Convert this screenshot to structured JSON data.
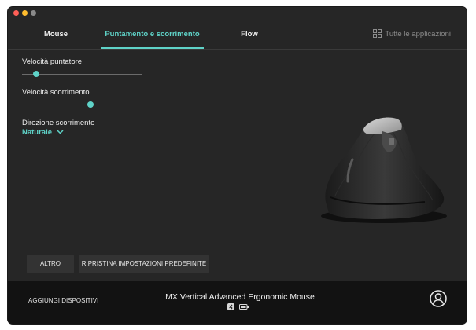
{
  "tabs": [
    {
      "label": "Mouse",
      "active": false
    },
    {
      "label": "Puntamento e scorrimento",
      "active": true
    },
    {
      "label": "Flow",
      "active": false
    }
  ],
  "apps_label": "Tutte le applicazioni",
  "settings": {
    "pointer_speed": {
      "label": "Velocità puntatore",
      "value_fraction": 0.12
    },
    "scroll_speed": {
      "label": "Velocità scorrimento",
      "value_fraction": 0.57
    },
    "scroll_direction": {
      "label": "Direzione scorrimento",
      "value": "Naturale"
    }
  },
  "buttons": {
    "more": "ALTRO",
    "reset": "RIPRISTINA IMPOSTAZIONI PREDEFINITE"
  },
  "footer": {
    "add_devices": "AGGIUNGI DISPOSITIVI",
    "device_name": "MX Vertical Advanced Ergonomic Mouse"
  },
  "colors": {
    "accent": "#5fd3c8",
    "background": "#262626",
    "footer": "#121212"
  },
  "icons": [
    "grid-apps-icon",
    "chevron-down-icon",
    "bluetooth-icon",
    "battery-icon",
    "user-profile-icon"
  ]
}
